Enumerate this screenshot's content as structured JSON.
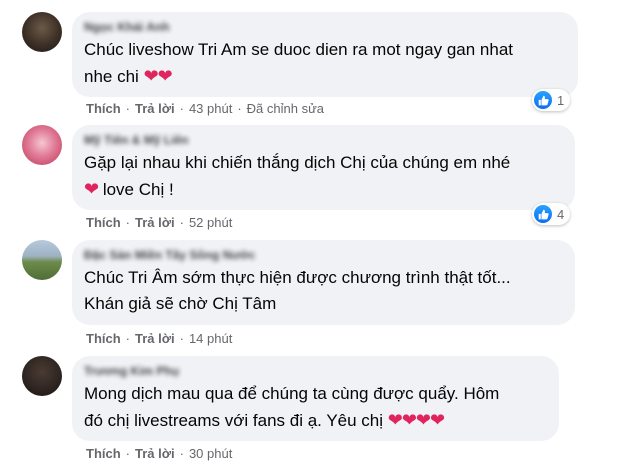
{
  "comments": [
    {
      "author": "Ngọc Khải Anh",
      "lines": [
        "Chúc liveshow Tri Am se duoc dien ra mot ngay gan nhat",
        "nhe chi"
      ],
      "hearts": "❤❤",
      "like": "Thích",
      "reply": "Trả lời",
      "time": "43 phút",
      "edited": "Đã chỉnh sửa",
      "reaction_count": "1"
    },
    {
      "author": "Mỹ Tiên & Mỹ Liên",
      "lines": [
        "Gặp lại nhau khi chiến thắng dịch Chị của chúng em nhé",
        "love Chị !"
      ],
      "hearts": "❤",
      "like": "Thích",
      "reply": "Trả lời",
      "time": "52 phút",
      "reaction_count": "4"
    },
    {
      "author": "Đặc Sản Miền Tây Sông Nước",
      "lines": [
        "Chúc Tri Âm sớm thực hiện được chương trình thật tốt...",
        "Khán giả sẽ chờ Chị Tâm"
      ],
      "like": "Thích",
      "reply": "Trả lời",
      "time": "14 phút"
    },
    {
      "author": "Trương Kim Phụ",
      "lines": [
        "Mong dịch mau qua để chúng ta cùng được quẩy. Hôm",
        "đó chị livestreams với fans đi ạ. Yêu chị"
      ],
      "hearts": "❤❤❤❤",
      "like": "Thích",
      "reply": "Trả lời",
      "time": "30 phút"
    }
  ],
  "colors": {
    "bubble": "#f0f2f5",
    "meta_text": "#65676b",
    "heart": "#e0245e",
    "like_blue": "#1877f2"
  }
}
